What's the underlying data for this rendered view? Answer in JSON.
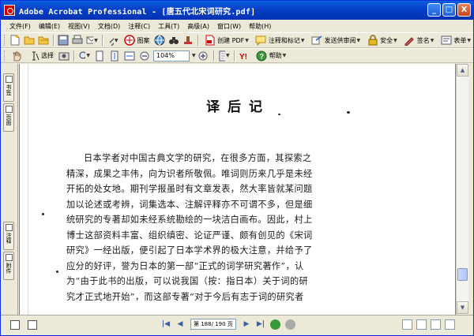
{
  "window": {
    "title": "Adobe Acrobat Professional - [唐五代北宋词研究.pdf]",
    "controls": {
      "minimize": "_",
      "maximize": "□",
      "close": "X"
    }
  },
  "menu": [
    "文件(F)",
    "编辑(E)",
    "视图(V)",
    "文档(D)",
    "注释(C)",
    "工具(T)",
    "高级(A)",
    "窗口(W)",
    "帮助(H)"
  ],
  "toolbar1": {
    "combine": "图案",
    "create_pdf": "创建 PDF",
    "comment_markup": "注释和标记",
    "send_review": "发送供审阅",
    "secure": "安全",
    "sign": "签名",
    "forms": "表单"
  },
  "toolbar2": {
    "select_label": "选择",
    "zoom_value": "104%",
    "help_label": "帮助"
  },
  "nav_tabs": [
    "书签",
    "页面",
    "注释",
    "附件"
  ],
  "document": {
    "heading": "译后记",
    "lines": [
      "日本学者对中国古典文学的研究，在很多方面，其探索之",
      "精深，成果之丰伟，向为识者所敬佩。唯词则历来几乎是未经",
      "开拓的处女地。期刊学报虽时有文章发表，然大率皆就某问题",
      "加以论述或考辨，词集选本、注解评释亦不可谓不多，但是细",
      "统研究的专著却如未经系统勘绘的一块洁白画布。因此，村上",
      "博士这部资料丰富、组织缜密、论证严谨、颇有创见的《宋词",
      "研究》一经出版，便引起了日本学术界的极大注意，并给予了",
      "应分的好评，誉为日本的第一部“正式的词学研究著作”，认",
      "为“由于此书的出版，可以说我国（按：指日本）关于词的研",
      "究才正式地开始”，而这部专著“对于今后有志于词的研究者"
    ]
  },
  "status": {
    "page_indicator": "第 188/ 190 页"
  }
}
